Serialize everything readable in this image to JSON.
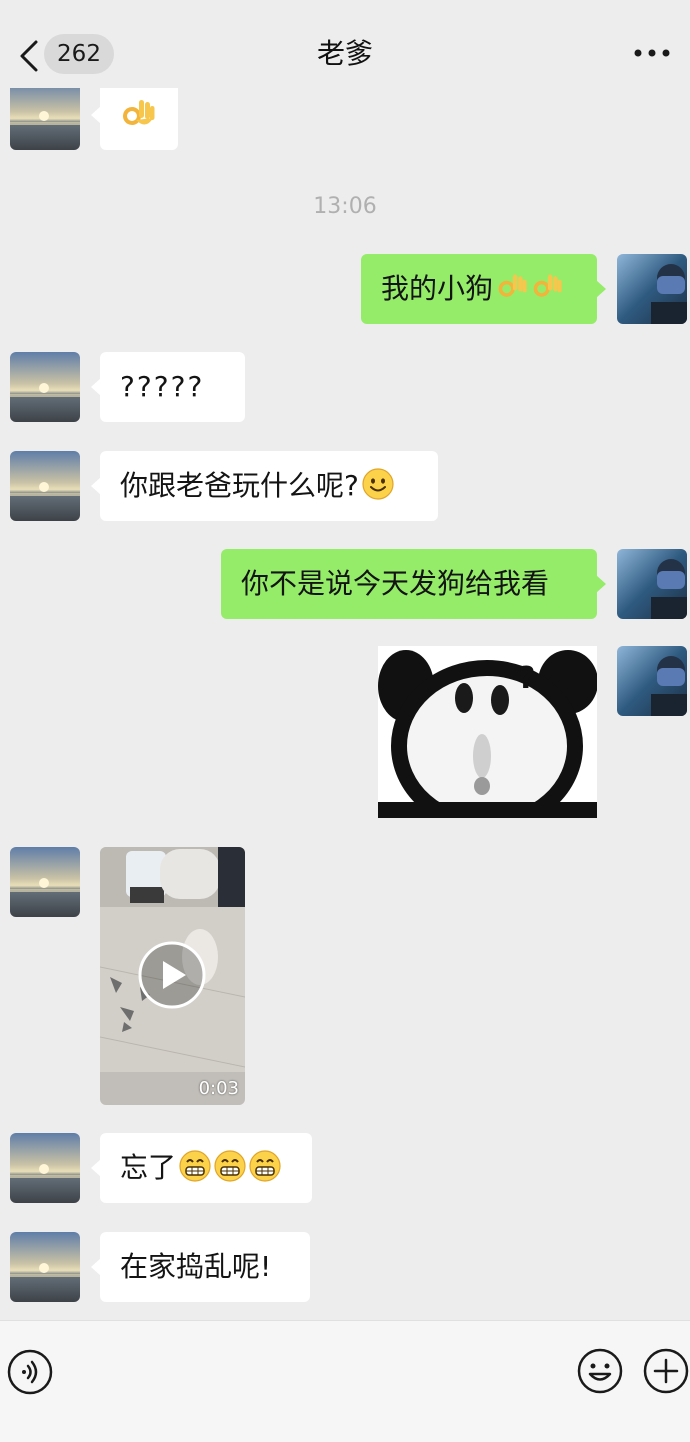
{
  "header": {
    "unread_count": "262",
    "title": "老爹"
  },
  "messages": [
    {
      "from": "them",
      "type": "emoji",
      "emoji": "ok-hand-emoji"
    },
    {
      "type": "timestamp",
      "text": "13:06"
    },
    {
      "from": "me",
      "type": "text",
      "text": "我的小狗",
      "emojis": [
        "ok-hand-emoji",
        "ok-hand-emoji"
      ]
    },
    {
      "from": "them",
      "type": "text",
      "text": "?????"
    },
    {
      "from": "them",
      "type": "text",
      "text": "你跟老爸玩什么呢?",
      "emojis": [
        "smile-emoji"
      ]
    },
    {
      "from": "me",
      "type": "text",
      "text": "你不是说今天发狗给我看"
    },
    {
      "from": "me",
      "type": "sticker",
      "sticker": "panda-question-sticker"
    },
    {
      "from": "them",
      "type": "video",
      "duration": "0:03"
    },
    {
      "from": "them",
      "type": "text",
      "text": "忘了",
      "emojis": [
        "grin-emoji",
        "grin-emoji",
        "grin-emoji"
      ]
    },
    {
      "from": "them",
      "type": "text",
      "text": "在家捣乱呢!"
    }
  ],
  "icons": {
    "back": "chevron-left-icon",
    "more": "more-dots-icon",
    "voice": "voice-icon",
    "emoji": "emoji-icon",
    "plus": "plus-icon"
  },
  "colors": {
    "outgoing_bubble": "#95ec69",
    "incoming_bubble": "#ffffff",
    "background": "#ededed"
  }
}
